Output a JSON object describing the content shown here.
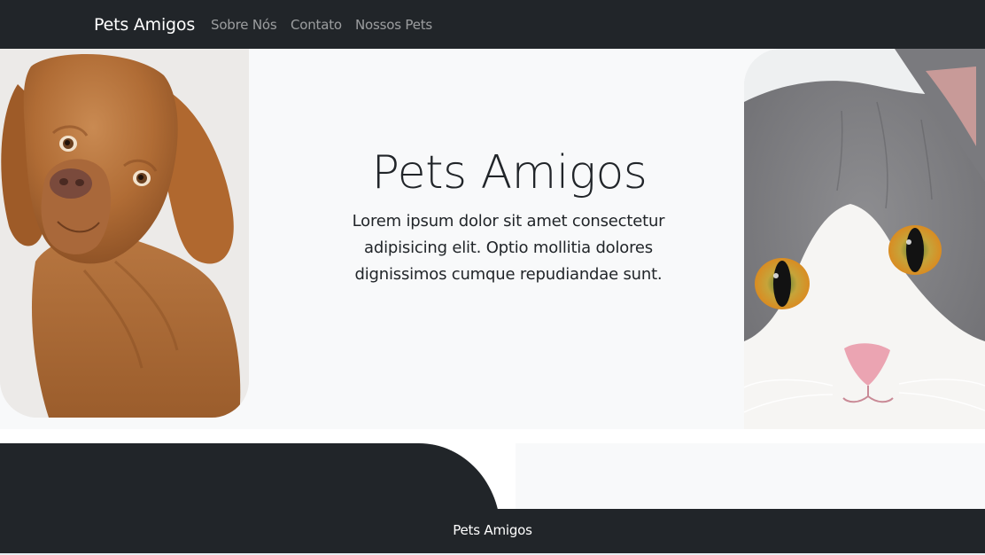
{
  "navbar": {
    "brand": "Pets Amigos",
    "links": [
      "Sobre Nós",
      "Contato",
      "Nossos Pets"
    ]
  },
  "hero": {
    "title": "Pets Amigos",
    "text": "Lorem ipsum dolor sit amet consectetur adipisicing elit. Optio mollitia dolores dignissimos cumque repudiandae sunt.",
    "left_image": "dog-photo",
    "right_image": "cat-photo"
  },
  "footer": {
    "text": "Pets Amigos"
  },
  "colors": {
    "dark": "#212529",
    "light": "#f8f9fa",
    "nav_link": "rgba(255,255,255,0.55)"
  }
}
